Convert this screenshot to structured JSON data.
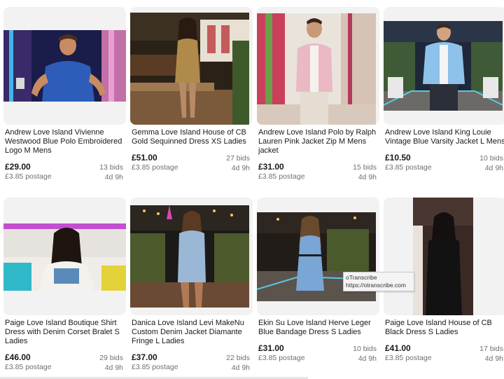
{
  "listings": [
    {
      "title": "Andrew Love Island Vivienne Westwood Blue Polo Embroidered Logo M Mens",
      "price": "£29.00",
      "postage": "£3.85 postage",
      "bids": "13 bids",
      "time_left": "4d 9h"
    },
    {
      "title": "Gemma Love Island House of CB Gold Sequinned Dress XS Ladies",
      "price": "£51.00",
      "postage": "£3.85 postage",
      "bids": "27 bids",
      "time_left": "4d 9h"
    },
    {
      "title": "Andrew Love Island Polo by Ralph Lauren Pink Jacket Zip M Mens jacket",
      "price": "£31.00",
      "postage": "£3.85 postage",
      "bids": "15 bids",
      "time_left": "4d 9h"
    },
    {
      "title": "Andrew Love Island King Louie Vintage Blue Varsity Jacket L Mens",
      "price": "£10.50",
      "postage": "£3.85 postage",
      "bids": "10 bids",
      "time_left": "4d 9h"
    },
    {
      "title": "Paige Love Island Boutique Shirt Dress with Denim Corset Bralet S Ladies",
      "price": "£46.00",
      "postage": "£3.85 postage",
      "bids": "29 bids",
      "time_left": "4d 9h"
    },
    {
      "title": "Danica Love Island Levi MakeNu Custom Denim Jacket Diamante Fringe L Ladies",
      "price": "£37.00",
      "postage": "£3.85 postage",
      "bids": "22 bids",
      "time_left": "4d 9h"
    },
    {
      "title": "Ekin Su Love Island Herve Leger Blue Bandage Dress S Ladies",
      "price": "£31.00",
      "postage": "£3.85 postage",
      "bids": "10 bids",
      "time_left": "4d 9h"
    },
    {
      "title": "Paige Love Island House of CB Black Dress S Ladies",
      "price": "£41.00",
      "postage": "£3.85 postage",
      "bids": "17 bids",
      "time_left": "4d 9h"
    }
  ],
  "tooltip": {
    "line1": "oTranscribe",
    "line2": "https://otranscribe.com"
  },
  "colors": {
    "price": "#191919",
    "meta": "#707070",
    "image_bg": "#f2f2f2"
  }
}
